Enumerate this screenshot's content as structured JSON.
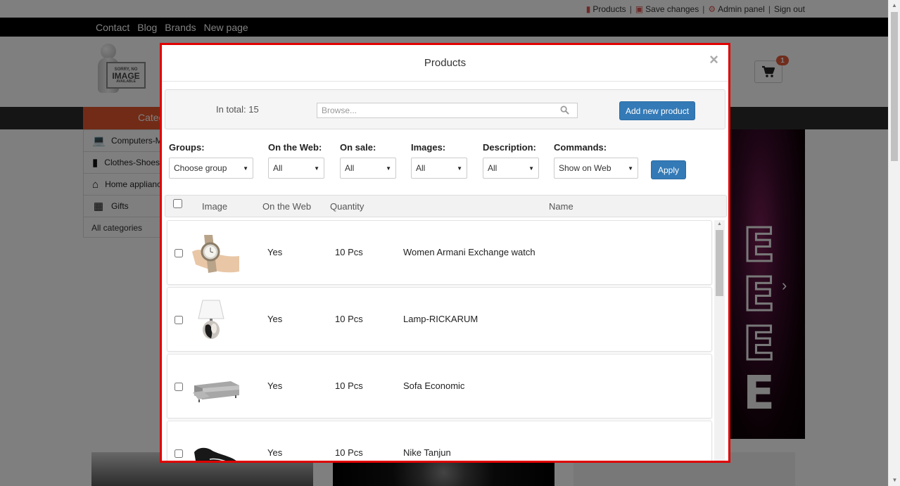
{
  "admin_bar": {
    "products": "Products",
    "save_changes": "Save changes",
    "admin_panel": "Admin panel",
    "sign_out": "Sign out",
    "separator": "|"
  },
  "top_nav": [
    "Contact",
    "Blog",
    "Brands",
    "New page"
  ],
  "logo": {
    "line1": "SORRY, NO",
    "line2": "IMAGE",
    "line3": "AVAILABLE"
  },
  "cart": {
    "count": "1"
  },
  "category_bar": {
    "tab_label": "Categories"
  },
  "category_menu": {
    "items": [
      "Computers-Mobile",
      "Clothes-Shoes",
      "Home appliances",
      "Gifts"
    ],
    "all_label": "All categories"
  },
  "banner": {
    "letters": [
      "E",
      "E",
      "E",
      "E"
    ]
  },
  "modal": {
    "title": "Products",
    "close": "×",
    "total_label": "In total: 15",
    "search_placeholder": "Browse...",
    "add_button": "Add new product",
    "filters": {
      "groups": {
        "label": "Groups:",
        "value": "Choose group"
      },
      "on_web": {
        "label": "On the Web:",
        "value": "All"
      },
      "on_sale": {
        "label": "On sale:",
        "value": "All"
      },
      "images": {
        "label": "Images:",
        "value": "All"
      },
      "description": {
        "label": "Description:",
        "value": "All"
      },
      "commands": {
        "label": "Commands:",
        "value": "Show on Web"
      }
    },
    "apply_button": "Apply",
    "columns": {
      "image": "Image",
      "on_web": "On the Web",
      "quantity": "Quantity",
      "name": "Name"
    },
    "rows": [
      {
        "on_web": "Yes",
        "quantity": "10 Pcs",
        "name": "Women Armani Exchange watch",
        "image": "watch"
      },
      {
        "on_web": "Yes",
        "quantity": "10 Pcs",
        "name": "Lamp-RICKARUM",
        "image": "lamp"
      },
      {
        "on_web": "Yes",
        "quantity": "10 Pcs",
        "name": "Sofa Economic",
        "image": "sofa"
      },
      {
        "on_web": "Yes",
        "quantity": "10 Pcs",
        "name": "Nike Tanjun",
        "image": "shoe"
      }
    ]
  },
  "colors": {
    "accent": "#337ab7",
    "modal_border": "#e00000",
    "category_tab": "#e2562d",
    "badge": "#e05a3a"
  }
}
